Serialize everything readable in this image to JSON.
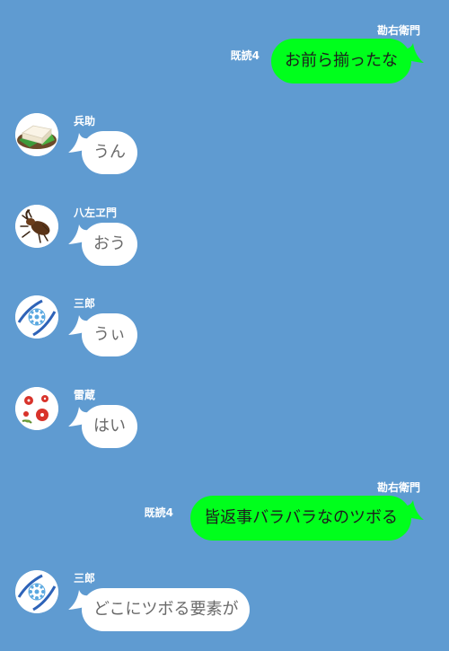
{
  "messages": [
    {
      "direction": "out",
      "sender": "勘右衛門",
      "read": "既読4",
      "text": "お前ら揃ったな"
    },
    {
      "direction": "in",
      "sender": "兵助",
      "avatar_icon": "tofu-icon",
      "text": "うん"
    },
    {
      "direction": "in",
      "sender": "八左ヱ門",
      "avatar_icon": "beetle-icon",
      "text": "おう"
    },
    {
      "direction": "in",
      "sender": "三郎",
      "avatar_icon": "flower-pattern-icon",
      "text": "うぃ"
    },
    {
      "direction": "in",
      "sender": "雷蔵",
      "avatar_icon": "red-flowers-icon",
      "text": "はい"
    },
    {
      "direction": "out",
      "sender": "勘右衛門",
      "read": "既読4",
      "text": "皆返事バラバラなのツボる"
    },
    {
      "direction": "in",
      "sender": "三郎",
      "avatar_icon": "flower-pattern-icon",
      "text": "どこにツボる要素が"
    }
  ],
  "colors": {
    "background": "#5f9bd1",
    "outgoing_bubble": "#00ff1c",
    "incoming_bubble": "#ffffff",
    "incoming_text": "#6a6a6a"
  }
}
